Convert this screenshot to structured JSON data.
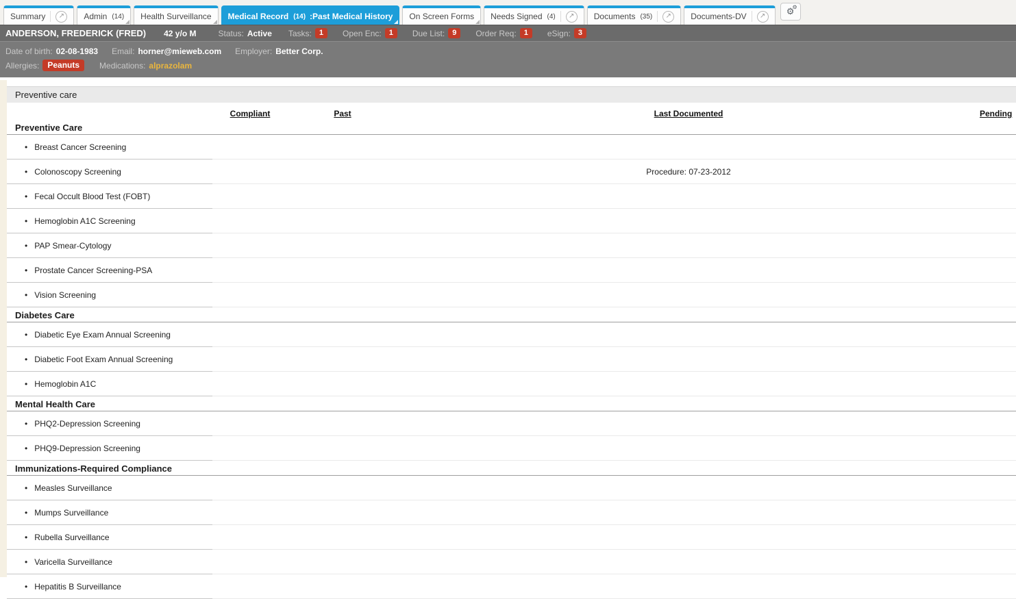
{
  "tabs": [
    {
      "label": "Summary"
    },
    {
      "label": "Admin",
      "count": "(14)"
    },
    {
      "label": "Health Surveillance"
    },
    {
      "label": "Medical Record",
      "count": "(14)",
      "suffix": ":Past Medical History"
    },
    {
      "label": "On Screen Forms"
    },
    {
      "label": "Needs Signed",
      "count": "(4)"
    },
    {
      "label": "Documents",
      "count": "(35)"
    },
    {
      "label": "Documents-DV"
    }
  ],
  "icons": {
    "popout": "popout-circle-arrow",
    "settings": "gears"
  },
  "patient_bar": {
    "name": "ANDERSON, FREDERICK (FRED)",
    "age_sex": "42 y/o M",
    "status_label": "Status:",
    "status_value": "Active",
    "counters": [
      {
        "label": "Tasks:",
        "value": "1"
      },
      {
        "label": "Open Enc:",
        "value": "1"
      },
      {
        "label": "Due List:",
        "value": "9"
      },
      {
        "label": "Order Req:",
        "value": "1"
      },
      {
        "label": "eSign:",
        "value": "3"
      }
    ]
  },
  "demographics": {
    "dob_label": "Date of birth:",
    "dob": "02-08-1983",
    "email_label": "Email:",
    "email": "horner@mieweb.com",
    "employer_label": "Employer:",
    "employer": "Better Corp.",
    "allergies_label": "Allergies:",
    "allergy": "Peanuts",
    "medications_label": "Medications:",
    "medication": "alprazolam"
  },
  "panel": {
    "title": "Preventive care"
  },
  "table": {
    "columns": [
      "Compliant",
      "Past",
      "Last Documented",
      "Pending"
    ],
    "sections": [
      {
        "title": "Preventive Care",
        "items": [
          {
            "name": "Breast Cancer Screening"
          },
          {
            "name": "Colonoscopy Screening",
            "last_documented": "Procedure: 07-23-2012"
          },
          {
            "name": "Fecal Occult Blood Test (FOBT)"
          },
          {
            "name": "Hemoglobin A1C Screening"
          },
          {
            "name": "PAP Smear-Cytology"
          },
          {
            "name": "Prostate Cancer Screening-PSA"
          },
          {
            "name": "Vision Screening"
          }
        ]
      },
      {
        "title": "Diabetes Care",
        "items": [
          {
            "name": "Diabetic Eye Exam Annual Screening"
          },
          {
            "name": "Diabetic Foot Exam Annual Screening"
          },
          {
            "name": "Hemoglobin A1C"
          }
        ]
      },
      {
        "title": "Mental Health Care",
        "items": [
          {
            "name": "PHQ2-Depression Screening"
          },
          {
            "name": "PHQ9-Depression Screening"
          }
        ]
      },
      {
        "title": "Immunizations-Required Compliance",
        "items": [
          {
            "name": "Measles Surveillance"
          },
          {
            "name": "Mumps Surveillance"
          },
          {
            "name": "Rubella Surveillance"
          },
          {
            "name": "Varicella Surveillance"
          },
          {
            "name": "Hepatitis B Surveillance"
          }
        ]
      }
    ]
  },
  "colors": {
    "accent_blue": "#1d9ed9",
    "badge_red": "#c43b27",
    "medication_gold": "#eab63e",
    "header_gray": "#6b6b6b",
    "demo_gray": "#7a7a7a",
    "panelbar_gray": "#eaeaea",
    "left_strip_beige": "#f5f0e3"
  }
}
